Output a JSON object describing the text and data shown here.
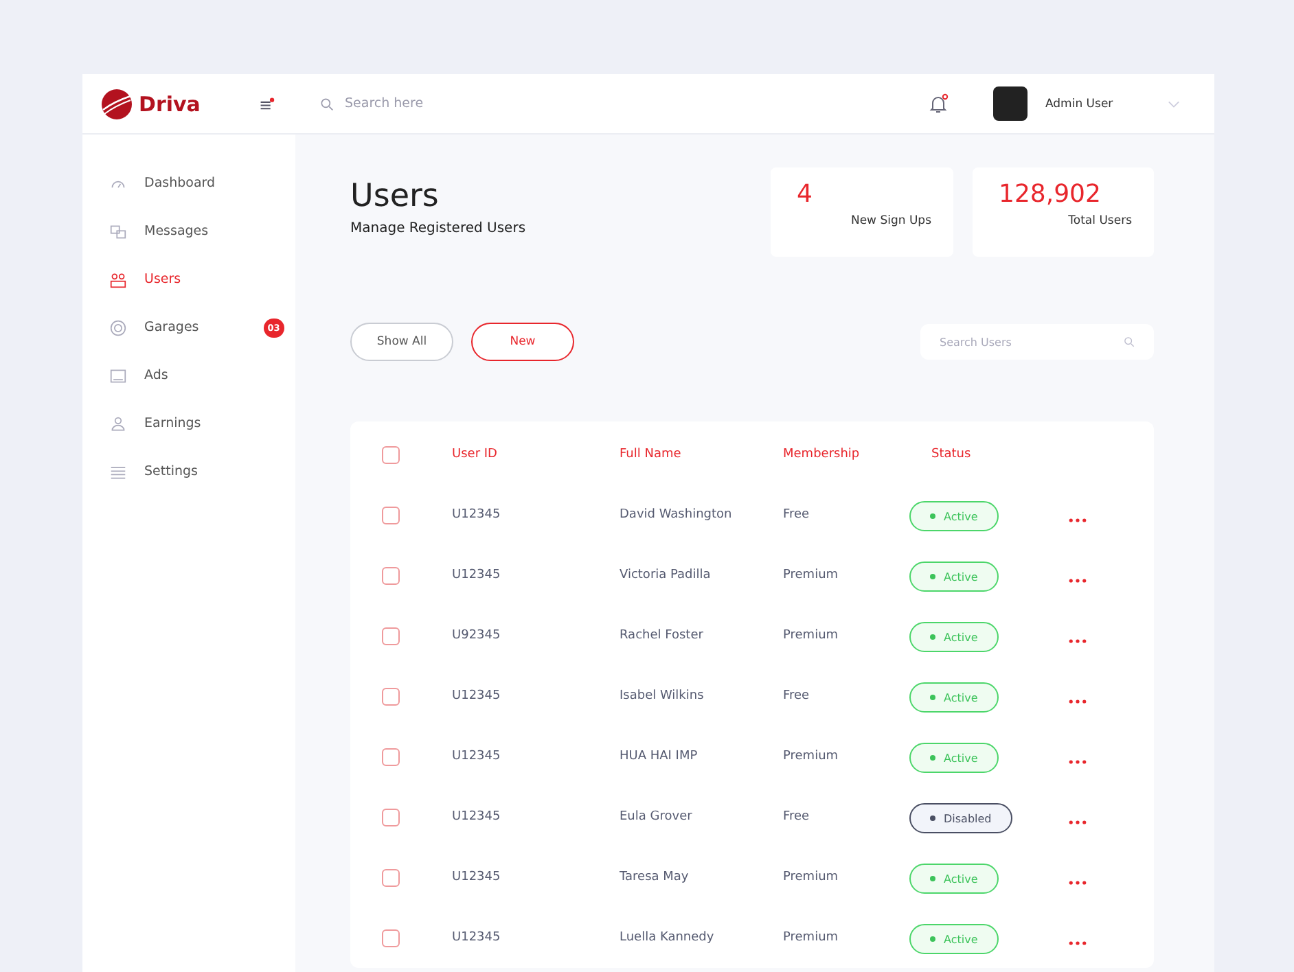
{
  "header": {
    "brand": "Driva",
    "search": {
      "placeholder": "Search here"
    },
    "user": {
      "name": "Admin User"
    }
  },
  "sidebar": {
    "items": [
      {
        "label": "Dashboard",
        "selected": false
      },
      {
        "label": "Messages",
        "selected": false
      },
      {
        "label": "Users",
        "selected": true
      },
      {
        "label": "Garages",
        "selected": false,
        "badge": "03"
      },
      {
        "label": "Ads",
        "selected": false
      },
      {
        "label": "Earnings",
        "selected": false
      },
      {
        "label": "Settings",
        "selected": false
      }
    ]
  },
  "page": {
    "title": "Users",
    "subtitle": "Manage Registered Users"
  },
  "stats": [
    {
      "value": "4",
      "label": "New Sign Ups"
    },
    {
      "value": "128,902",
      "label": "Total Users"
    }
  ],
  "filters": [
    {
      "label": "Show All",
      "selected": false
    },
    {
      "label": "New",
      "selected": true
    }
  ],
  "user_search": {
    "placeholder": "Search Users"
  },
  "table": {
    "select_all_checked": false,
    "columns": [
      "User ID",
      "Full Name",
      "Membership",
      "Status"
    ],
    "rows": [
      {
        "checked": false,
        "id": "U12345",
        "name": "David Washington",
        "membership": "Free",
        "status": "Active",
        "kind": "active"
      },
      {
        "checked": false,
        "id": "U12345",
        "name": "Victoria Padilla",
        "membership": "Premium",
        "status": "Active",
        "kind": "active"
      },
      {
        "checked": false,
        "id": "U92345",
        "name": "Rachel Foster",
        "membership": "Premium",
        "status": "Active",
        "kind": "active"
      },
      {
        "checked": false,
        "id": "U12345",
        "name": "Isabel Wilkins",
        "membership": "Free",
        "status": "Active",
        "kind": "active"
      },
      {
        "checked": false,
        "id": "U12345",
        "name": "HUA HAI IMP",
        "membership": "Premium",
        "status": "Active",
        "kind": "active"
      },
      {
        "checked": false,
        "id": "U12345",
        "name": "Eula Grover",
        "membership": "Free",
        "status": "Disabled",
        "kind": "disabled"
      },
      {
        "checked": false,
        "id": "U12345",
        "name": "Taresa May",
        "membership": "Premium",
        "status": "Active",
        "kind": "active"
      },
      {
        "checked": false,
        "id": "U12345",
        "name": "Luella Kannedy",
        "membership": "Premium",
        "status": "Active",
        "kind": "active"
      }
    ]
  }
}
